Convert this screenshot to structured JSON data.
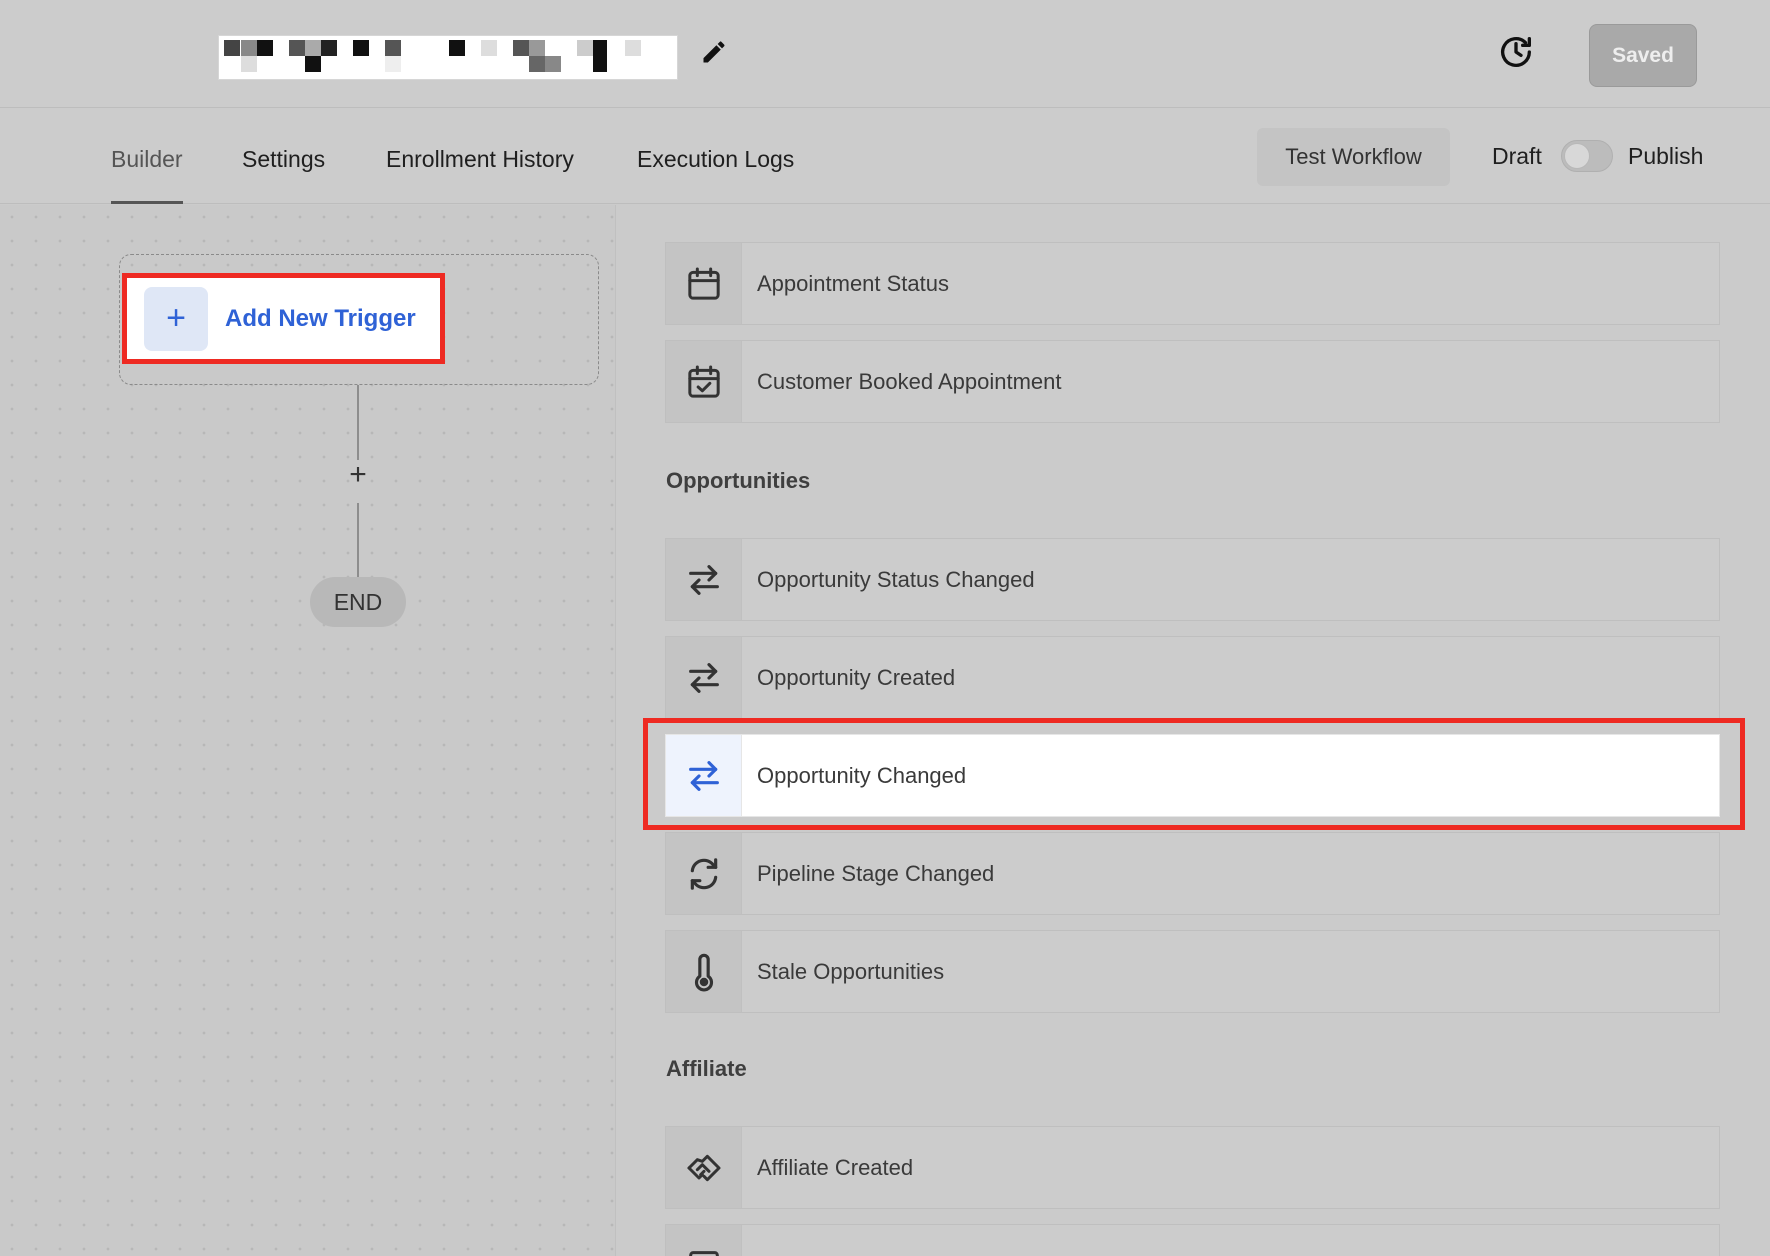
{
  "header": {
    "edit_icon": "pencil-icon",
    "history_icon": "clock-history-icon",
    "saved_label": "Saved"
  },
  "tabs": [
    {
      "label": "Builder",
      "active": true
    },
    {
      "label": "Settings",
      "active": false
    },
    {
      "label": "Enrollment History",
      "active": false
    },
    {
      "label": "Execution Logs",
      "active": false
    }
  ],
  "actions": {
    "test_workflow_label": "Test Workflow",
    "draft_label": "Draft",
    "publish_label": "Publish",
    "publish_toggle_on": false
  },
  "canvas": {
    "add_trigger_label": "Add New Trigger",
    "add_step_symbol": "+",
    "end_label": "END"
  },
  "trigger_list": {
    "appointment_items": [
      {
        "label": "Appointment Status",
        "icon": "calendar-icon"
      },
      {
        "label": "Customer Booked Appointment",
        "icon": "calendar-check-icon"
      }
    ],
    "opportunities_title": "Opportunities",
    "opportunity_items": [
      {
        "label": "Opportunity Status Changed",
        "icon": "arrows-swap-icon"
      },
      {
        "label": "Opportunity Created",
        "icon": "arrows-swap-icon"
      },
      {
        "label": "Opportunity Changed",
        "icon": "arrows-swap-icon",
        "selected": true
      },
      {
        "label": "Pipeline Stage Changed",
        "icon": "refresh-icon"
      },
      {
        "label": "Stale Opportunities",
        "icon": "thermometer-icon"
      }
    ],
    "affiliate_title": "Affiliate",
    "affiliate_items": [
      {
        "label": "Affiliate Created",
        "icon": "handshake-icon"
      }
    ]
  },
  "colors": {
    "accent_blue": "#2f62d6",
    "highlight_red": "#ee2a22"
  }
}
